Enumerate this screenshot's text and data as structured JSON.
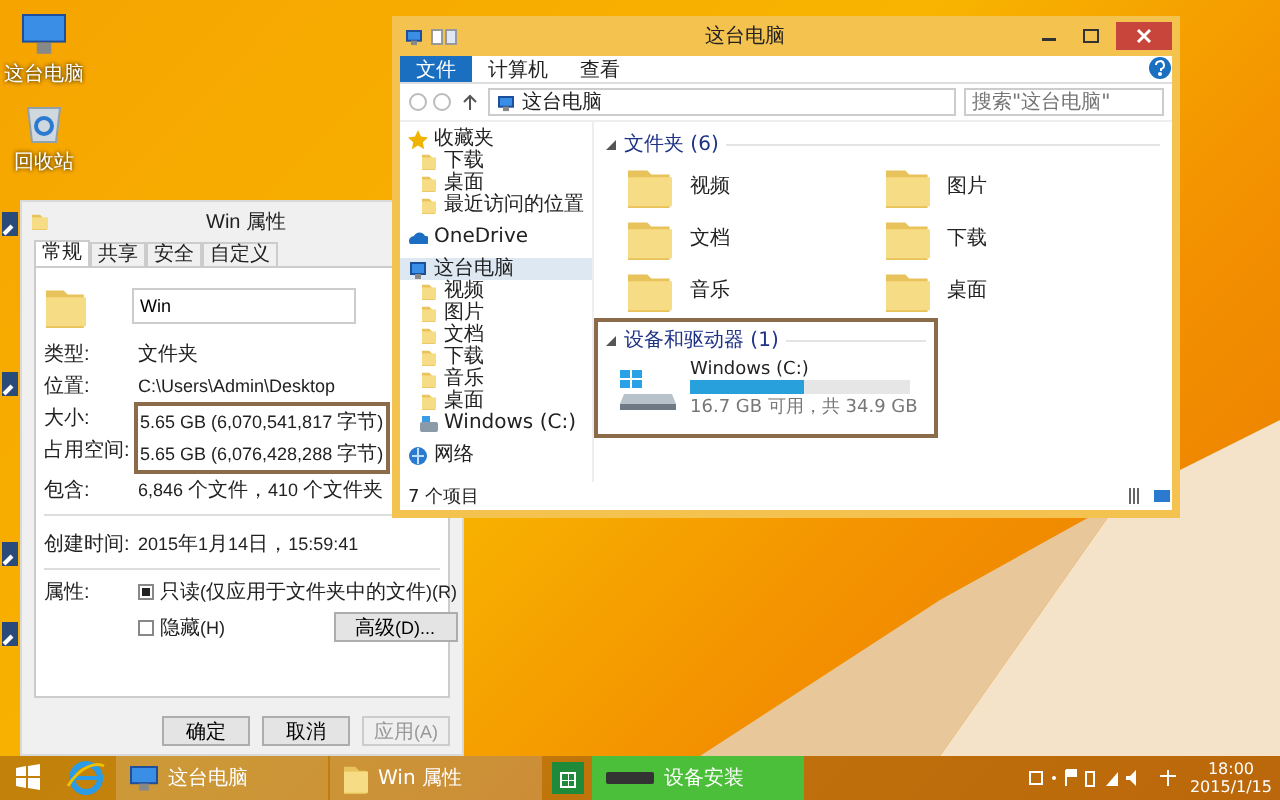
{
  "desktop": {
    "icons": [
      {
        "label": "这台电脑",
        "kind": "computer"
      },
      {
        "label": "回收站",
        "kind": "bin"
      }
    ]
  },
  "explorer": {
    "title": "这台电脑",
    "ribbon_tabs": [
      {
        "label": "文件",
        "selected": true
      },
      {
        "label": "计算机",
        "selected": false
      },
      {
        "label": "查看",
        "selected": false
      }
    ],
    "address": "这台电脑",
    "search": {
      "placeholder": "搜索\"这台电脑\""
    },
    "nav": [
      {
        "label": "收藏夹",
        "kind": "star",
        "selected": false,
        "children": [
          {
            "label": "下载",
            "kind": "folder",
            "selected": false
          },
          {
            "label": "桌面",
            "kind": "folder",
            "selected": false
          },
          {
            "label": "最近访问的位置",
            "kind": "folder",
            "selected": false
          }
        ]
      },
      {
        "label": "OneDrive",
        "kind": "cloud",
        "selected": false
      },
      {
        "label": "这台电脑",
        "kind": "computer",
        "selected": true,
        "children": [
          {
            "label": "视频",
            "kind": "folder",
            "selected": false
          },
          {
            "label": "图片",
            "kind": "folder",
            "selected": false
          },
          {
            "label": "文档",
            "kind": "folder",
            "selected": false
          },
          {
            "label": "下载",
            "kind": "folder",
            "selected": false
          },
          {
            "label": "音乐",
            "kind": "folder",
            "selected": false
          },
          {
            "label": "桌面",
            "kind": "folder",
            "selected": false
          },
          {
            "label": "Windows (C:)",
            "kind": "drive",
            "selected": false
          }
        ]
      },
      {
        "label": "网络",
        "kind": "network",
        "selected": false
      }
    ],
    "folders": {
      "heading": "文件夹 (6)",
      "items": [
        "视频",
        "图片",
        "文档",
        "下载",
        "音乐",
        "桌面"
      ]
    },
    "devices": {
      "heading": "设备和驱动器 (1)",
      "items": [
        {
          "name": "Windows (C:)",
          "level": 0.52,
          "info": "16.7 GB 可用，共 34.9 GB"
        }
      ]
    },
    "status_bar": "7 个项目"
  },
  "properties": {
    "title": "Win 属性",
    "tabs": [
      {
        "label": "常规",
        "selected": true
      },
      {
        "label": "共享",
        "selected": false
      },
      {
        "label": "安全",
        "selected": false
      },
      {
        "label": "自定义",
        "selected": false
      }
    ],
    "name": "Win",
    "groups": [
      [
        {
          "label": "类型:",
          "value": "文件夹"
        },
        {
          "label": "位置:",
          "value": "C:\\Users\\Admin\\Desktop"
        },
        {
          "label": "大小:",
          "value": "5.65 GB (6,070,541,817 字节)",
          "highlighted": true
        },
        {
          "label": "占用空间:",
          "value": "5.65 GB (6,076,428,288 字节)",
          "highlighted": true
        },
        {
          "label": "包含:",
          "value": "6,846 个文件，410 个文件夹"
        }
      ],
      [
        {
          "label": "创建时间:",
          "value": "2015年1月14日，15:59:41"
        }
      ]
    ],
    "attributes_label": "属性:",
    "attributes": [
      {
        "label": "只读(仅应用于文件夹中的文件)(R)",
        "checked": true
      },
      {
        "label": "隐藏(H)",
        "checked": false
      }
    ],
    "advanced_button": "高级(D)...",
    "buttons": [
      {
        "label": "确定",
        "disabled": false
      },
      {
        "label": "取消",
        "disabled": false
      },
      {
        "label": "应用(A)",
        "disabled": true
      }
    ]
  },
  "taskbar": {
    "items": [
      {
        "kind": "start"
      },
      {
        "kind": "ie"
      },
      {
        "kind": "computer",
        "label": "这台电脑"
      },
      {
        "kind": "folder",
        "label": "Win 属性"
      },
      {
        "kind": "store"
      },
      {
        "kind": "device",
        "label": "设备安装",
        "selected": true
      }
    ],
    "time": "18:00",
    "date": "2015/1/15"
  }
}
